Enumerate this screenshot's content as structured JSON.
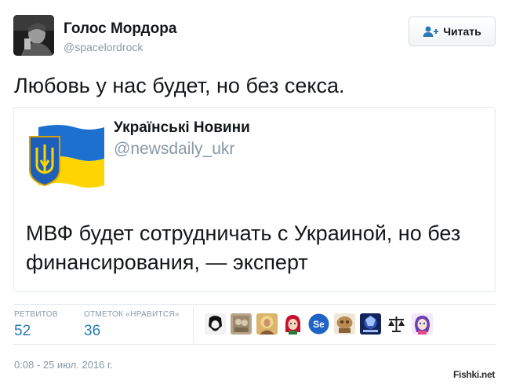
{
  "author": {
    "name": "Голос Мордора",
    "handle": "@spacelordrock"
  },
  "follow_button": {
    "label": "Читать",
    "icon": "add-user-icon"
  },
  "tweet": {
    "text": "Любовь у нас будет, но без секса."
  },
  "quoted_tweet": {
    "name": "Українські Новини",
    "handle": "@newsdaily_ukr",
    "text": "МВФ будет сотрудничать с Украиной, но без финансирования, — эксперт",
    "avatar_icon": "ukraine-flag-trident-icon"
  },
  "stats": {
    "retweets_label": "РЕТВИТОВ",
    "retweets_value": "52",
    "likes_label": "ОТМЕТОК «НРАВИТСЯ»",
    "likes_value": "36"
  },
  "likers": [
    "che-guevara-avatar",
    "sepia-photo-avatar",
    "icon-painting-avatar",
    "red-hair-cartoon-avatar",
    "se-logo-avatar",
    "toy-figure-avatar",
    "blue-emblem-avatar",
    "scales-of-justice-avatar",
    "anime-girl-avatar"
  ],
  "timestamp": "0:08 - 25 июл. 2016 г.",
  "watermark": "Fishki.net",
  "colors": {
    "link": "#2b7bb9",
    "muted": "#8899a6",
    "border": "#e1e8ed",
    "flag_blue": "#1d6fd0",
    "flag_yellow": "#ffd500"
  }
}
